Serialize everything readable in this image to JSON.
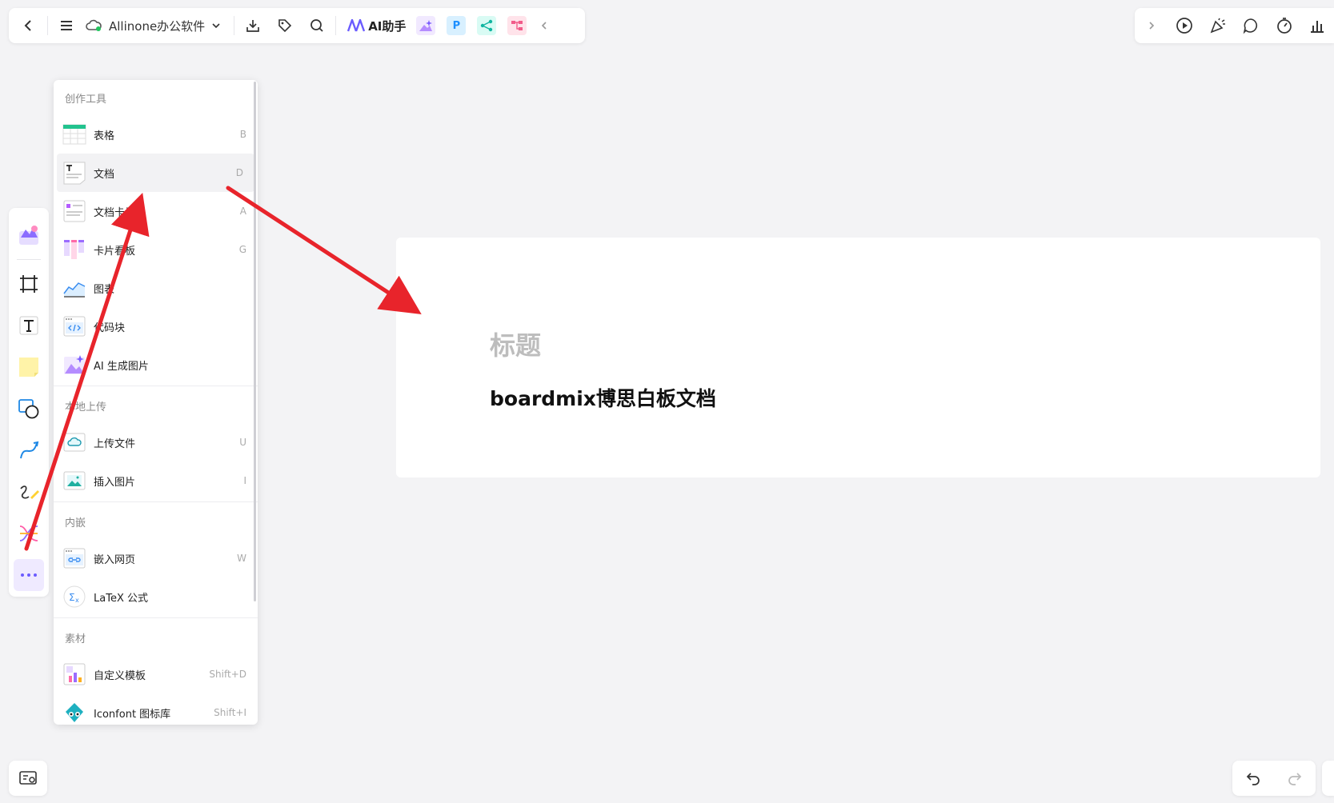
{
  "toolbar": {
    "file_name": "Allinone办公软件",
    "ai_label": "AI助手",
    "apps": [
      {
        "name": "image-app",
        "glyph": ""
      },
      {
        "name": "p-app",
        "glyph": "P"
      },
      {
        "name": "share-app",
        "glyph": ""
      },
      {
        "name": "mindmap-app",
        "glyph": ""
      }
    ]
  },
  "menu": {
    "sections": {
      "create": "创作工具",
      "upload": "本地上传",
      "embed": "内嵌",
      "material": "素材"
    },
    "create_items": [
      {
        "label": "表格",
        "key": "B",
        "icon": "table-icon"
      },
      {
        "label": "文档",
        "key": "D",
        "icon": "document-icon"
      },
      {
        "label": "文档卡片",
        "key": "A",
        "icon": "doc-card-icon"
      },
      {
        "label": "卡片看板",
        "key": "G",
        "icon": "kanban-icon"
      },
      {
        "label": "图表",
        "key": "",
        "icon": "chart-icon"
      },
      {
        "label": "代码块",
        "key": "",
        "icon": "code-block-icon"
      },
      {
        "label": "AI 生成图片",
        "key": "",
        "icon": "ai-image-icon"
      }
    ],
    "upload_items": [
      {
        "label": "上传文件",
        "key": "U",
        "icon": "upload-file-icon"
      },
      {
        "label": "插入图片",
        "key": "I",
        "icon": "insert-image-icon"
      }
    ],
    "embed_items": [
      {
        "label": "嵌入网页",
        "key": "W",
        "icon": "embed-web-icon"
      },
      {
        "label": "LaTeX 公式",
        "key": "",
        "icon": "latex-icon"
      }
    ],
    "material_items": [
      {
        "label": "自定义模板",
        "key": "Shift+D",
        "icon": "template-icon"
      },
      {
        "label": "Iconfont 图标库",
        "key": "Shift+I",
        "icon": "iconfont-icon"
      }
    ]
  },
  "card": {
    "title": "标题",
    "body": "boardmix博思白板文档"
  },
  "colors": {
    "accent": "#7b5cff",
    "arrow": "#e8242b"
  }
}
